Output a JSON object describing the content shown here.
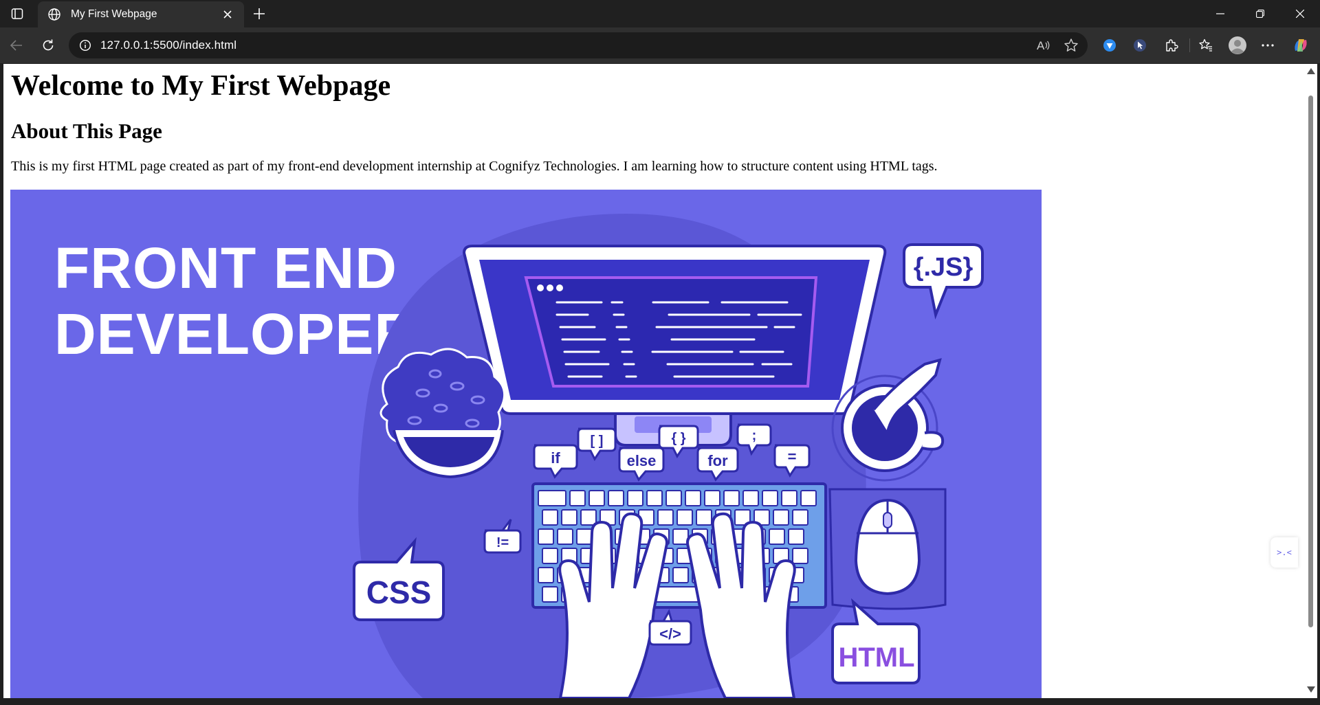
{
  "browser": {
    "tab": {
      "title": "My First Webpage"
    },
    "address": {
      "url": "127.0.0.1:5500/index.html"
    },
    "icons": [
      "tab-actions-icon",
      "globe-icon",
      "close-icon",
      "plus-icon",
      "minimize-icon",
      "restore-icon",
      "close-window-icon",
      "back-icon",
      "refresh-icon",
      "info-icon",
      "read-aloud-icon",
      "favorite-star-icon",
      "extension-icon",
      "favorites-icon",
      "profile-icon",
      "more-icon",
      "copilot-icon"
    ]
  },
  "page": {
    "heading": "Welcome to My First Webpage",
    "subheading": "About This Page",
    "paragraph": "This is my first HTML page created as part of my front-end development internship at Cognifyz Technologies. I am learning how to structure content using HTML tags.",
    "hero": {
      "title_line1": "FRONT END",
      "title_line2": "DEVELOPER",
      "bubbles": {
        "js": "{.JS}",
        "css": "CSS",
        "html": "HTML",
        "if": "if",
        "brackets": "[ ]",
        "else": "else",
        "braces": "{ }",
        "for": "for",
        "semicolon": ";",
        "equals": "=",
        "not_equal": "!=",
        "tag": "</>"
      },
      "colors": {
        "background": "#6a67e8",
        "dark": "#2e2aa8",
        "light": "#ffffff",
        "accent": "#8a4fe0"
      }
    },
    "side_widget": ">.<"
  }
}
